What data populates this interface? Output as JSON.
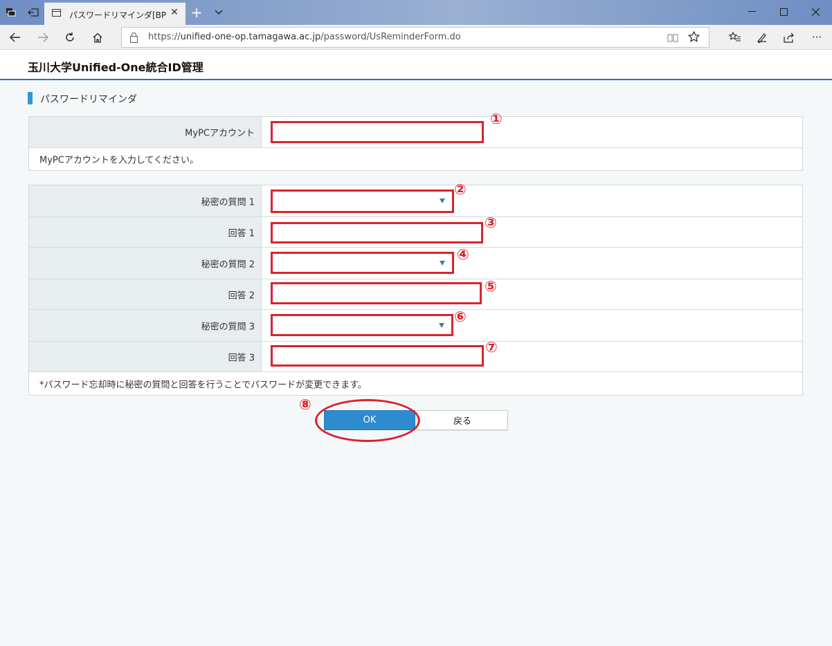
{
  "browser": {
    "tab_title": "パスワードリマインダ[BPUAC",
    "url_prefix": "https://",
    "url_domain": "unified-one-op.tamagawa.ac.jp",
    "url_path": "/password/UsReminderForm.do"
  },
  "header": {
    "site_title": "玉川大学Unified-One統合ID管理"
  },
  "section_title": "パスワードリマインダ",
  "account_table": {
    "label": "MyPCアカウント",
    "value": "",
    "note": "MyPCアカウントを入力してください。"
  },
  "question_table": {
    "q1_label": "秘密の質問 1",
    "a1_label": "回答 1",
    "q2_label": "秘密の質問 2",
    "a2_label": "回答 2",
    "q3_label": "秘密の質問 3",
    "a3_label": "回答 3",
    "note": "*パスワード忘却時に秘密の質問と回答を行うことでパスワードが変更できます。"
  },
  "annotations": [
    "①",
    "②",
    "③",
    "④",
    "⑤",
    "⑥",
    "⑦",
    "⑧"
  ],
  "buttons": {
    "ok": "OK",
    "back": "戻る"
  },
  "colors": {
    "annotation": "#d9232e",
    "ok_button": "#2d8bcf",
    "section_bar": "#2d9ad6",
    "header_rule": "#2e6fa8"
  }
}
